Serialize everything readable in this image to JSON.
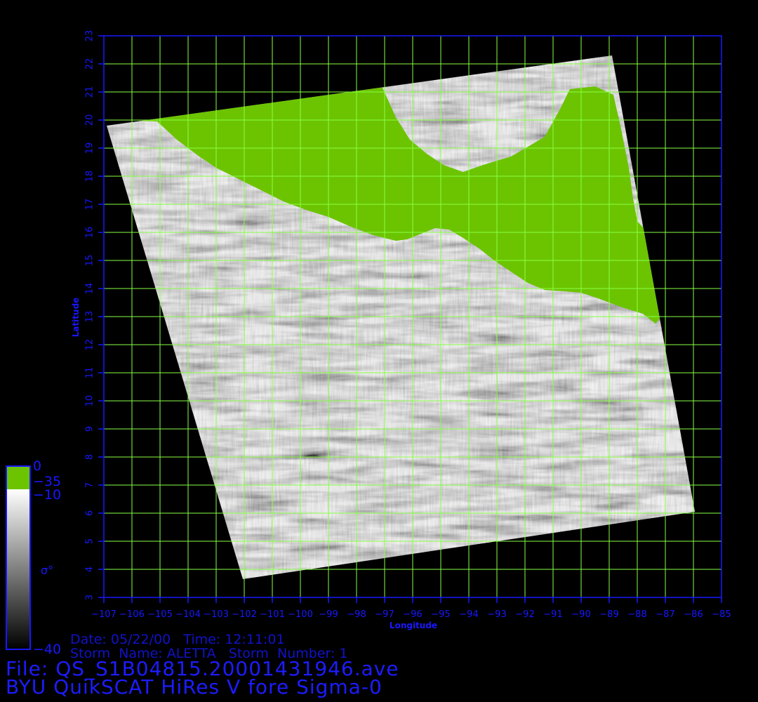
{
  "map": {
    "xlabel": "Longitude",
    "ylabel": "Latitude",
    "xlim": [
      -107,
      -85
    ],
    "ylim": [
      3,
      23
    ],
    "x_ticks": [
      "-107",
      "-106",
      "-105",
      "-104",
      "-103",
      "-102",
      "-101",
      "-100",
      "-99",
      "-98",
      "-97",
      "-96",
      "-95",
      "-94",
      "-93",
      "-92",
      "-91",
      "-90",
      "-89",
      "-88",
      "-87",
      "-86",
      "-85"
    ],
    "y_ticks": [
      "3",
      "4",
      "5",
      "6",
      "7",
      "8",
      "9",
      "10",
      "11",
      "12",
      "13",
      "14",
      "15",
      "16",
      "17",
      "18",
      "19",
      "20",
      "21",
      "22",
      "23"
    ],
    "grid": true,
    "colors": {
      "background": "#000000",
      "axis": "#1818ff",
      "grid": "#88ff44",
      "land": "#6cc400"
    },
    "swath_corners_lonlat": [
      {
        "corner": "north-west",
        "lon": -106.9,
        "lat": 19.8
      },
      {
        "corner": "north-east",
        "lon": -88.9,
        "lat": 22.3
      },
      {
        "corner": "south-east",
        "lon": -85.95,
        "lat": 6.05
      },
      {
        "corner": "south-west",
        "lon": -102.05,
        "lat": 3.65
      }
    ],
    "land_outline_lonlat": [
      [
        -105.1,
        19.95
      ],
      [
        -104.4,
        19.3
      ],
      [
        -103.6,
        18.7
      ],
      [
        -103.0,
        18.3
      ],
      [
        -102.2,
        17.9
      ],
      [
        -101.4,
        17.5
      ],
      [
        -100.6,
        17.1
      ],
      [
        -99.8,
        16.8
      ],
      [
        -99.0,
        16.55
      ],
      [
        -98.2,
        16.2
      ],
      [
        -97.4,
        15.9
      ],
      [
        -96.6,
        15.7
      ],
      [
        -96.2,
        15.75
      ],
      [
        -95.7,
        15.95
      ],
      [
        -95.2,
        16.15
      ],
      [
        -94.7,
        16.1
      ],
      [
        -94.2,
        15.8
      ],
      [
        -93.6,
        15.4
      ],
      [
        -93.1,
        15.0
      ],
      [
        -92.5,
        14.6
      ],
      [
        -91.9,
        14.2
      ],
      [
        -91.3,
        13.95
      ],
      [
        -90.6,
        13.9
      ],
      [
        -90.0,
        13.85
      ],
      [
        -89.4,
        13.65
      ],
      [
        -88.6,
        13.35
      ],
      [
        -87.8,
        13.1
      ],
      [
        -87.35,
        12.75
      ],
      [
        -87.1,
        13.05
      ],
      [
        -87.6,
        15.95
      ],
      [
        -88.0,
        16.4
      ],
      [
        -88.15,
        17.2
      ],
      [
        -88.3,
        18.3
      ],
      [
        -88.6,
        19.8
      ],
      [
        -88.85,
        20.9
      ],
      [
        -89.5,
        21.2
      ],
      [
        -90.4,
        21.1
      ],
      [
        -90.8,
        20.3
      ],
      [
        -91.3,
        19.4
      ],
      [
        -92.5,
        18.7
      ],
      [
        -93.5,
        18.4
      ],
      [
        -94.2,
        18.15
      ],
      [
        -94.9,
        18.4
      ],
      [
        -95.5,
        18.8
      ],
      [
        -96.1,
        19.3
      ],
      [
        -96.6,
        20.1
      ],
      [
        -97.1,
        21.2
      ],
      [
        -97.25,
        21.3
      ],
      [
        -105.75,
        19.97
      ]
    ]
  },
  "colorbar": {
    "label": "σ°",
    "colors": {
      "land": "#6cc400",
      "top": "#ffffff",
      "bottom": "#000000",
      "border": "#1818ff"
    },
    "tick_labels": {
      "land_top": "0",
      "land_bottom": "−35",
      "scale_top": "−10",
      "scale_bottom": "−40"
    }
  },
  "info": {
    "date_line": "Date: 05/22/00   Time: 12:11:01",
    "storm_line": "Storm  Name: ALETTA   Storm  Number: 1",
    "file_line": "File: QS_S1B04815.20001431946.ave",
    "product_line": "BYU QuikSCAT HiRes V fore Sigma-0"
  }
}
